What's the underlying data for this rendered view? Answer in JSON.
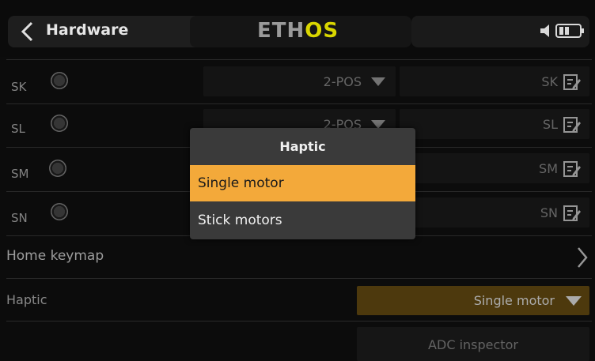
{
  "header": {
    "title": "Hardware",
    "brand_prefix": "ETH",
    "brand_accent": "OS"
  },
  "switches": [
    {
      "name": "SK",
      "type": "2-POS",
      "alias": "SK"
    },
    {
      "name": "SL",
      "type": "2-POS",
      "alias": "SL"
    },
    {
      "name": "SM",
      "type": "",
      "alias": "SM"
    },
    {
      "name": "SN",
      "type": "",
      "alias": "SN"
    }
  ],
  "home_keymap": {
    "label": "Home keymap"
  },
  "haptic": {
    "label": "Haptic",
    "value": "Single motor"
  },
  "adc": {
    "label": "ADC inspector"
  },
  "popup": {
    "title": "Haptic",
    "options": [
      "Single motor",
      "Stick motors"
    ],
    "selected": "Single motor"
  },
  "colors": {
    "accent": "#f3a93a",
    "brand_accent": "#d9d600",
    "selected_field": "#6b4f12"
  }
}
